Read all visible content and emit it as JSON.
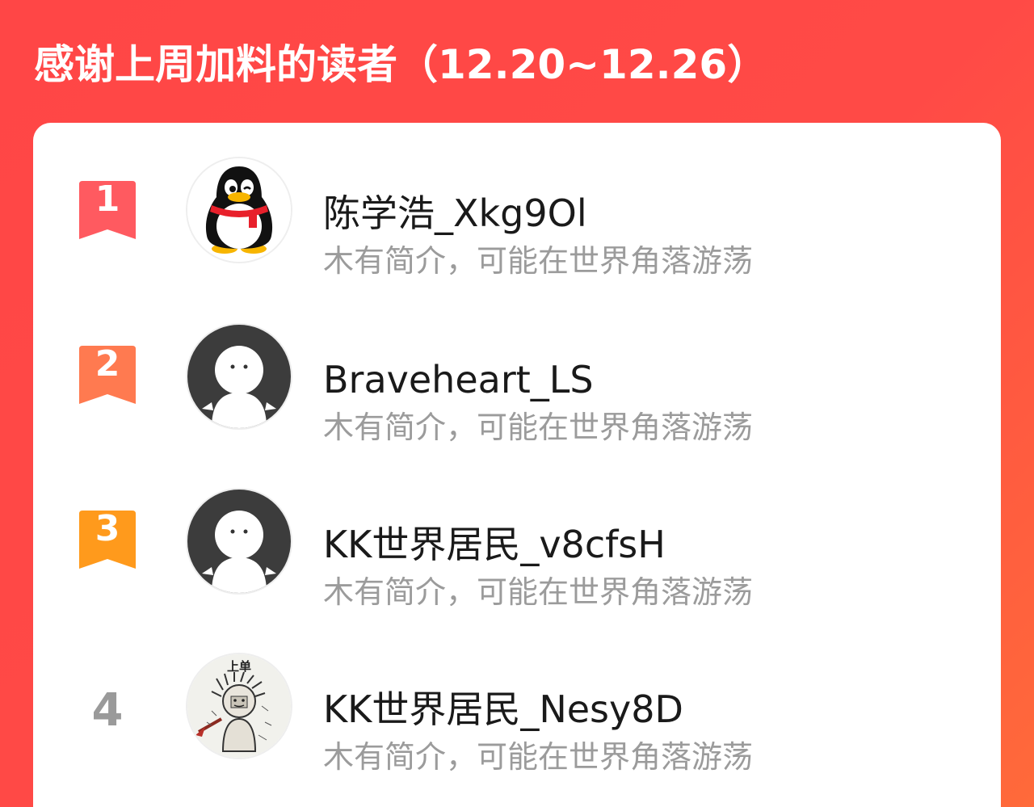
{
  "page": {
    "title": "感谢上周加料的读者（12.20~12.26）"
  },
  "colors": {
    "background_top": "#ff4646",
    "background_bottom_right": "#ff6a3a",
    "rank1_badge": "#ff5a60",
    "rank2_badge": "#ff7a50",
    "rank3_badge": "#ff9a1c",
    "rank_plain": "#9a9a9a",
    "name_text": "#1a1a1a",
    "bio_text": "#9b9b9b"
  },
  "readers": [
    {
      "rank": "1",
      "name": "陈学浩_Xkg9Ol",
      "bio": "木有简介，可能在世界角落游荡",
      "avatar": "penguin-avatar-icon"
    },
    {
      "rank": "2",
      "name": "Braveheart_LS",
      "bio": "木有简介，可能在世界角落游荡",
      "avatar": "default-user-avatar-icon"
    },
    {
      "rank": "3",
      "name": "KK世界居民_v8cfsH",
      "bio": "木有简介，可能在世界角落游荡",
      "avatar": "default-user-avatar-icon"
    },
    {
      "rank": "4",
      "name": "KK世界居民_Nesy8D",
      "bio": "木有简介，可能在世界角落游荡",
      "avatar": "sketch-drawing-avatar",
      "avatar_caption": "上单"
    }
  ]
}
